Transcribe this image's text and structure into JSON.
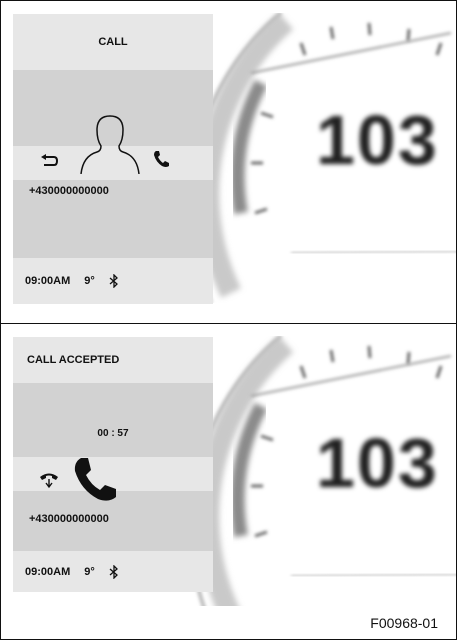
{
  "incoming_call": {
    "header": "CALL",
    "phone_number": "+430000000000",
    "status_bar": {
      "time": "09:00AM",
      "temperature": "9°",
      "bluetooth_icon": "bluetooth-icon"
    },
    "icons": [
      "back-arrow-icon",
      "person-silhouette-icon",
      "phone-handset-icon"
    ],
    "speed": "103"
  },
  "accepted_call": {
    "header": "CALL ACCEPTED",
    "call_duration": "00 : 57",
    "phone_number": "+430000000000",
    "status_bar": {
      "time": "09:00AM",
      "temperature": "9°",
      "bluetooth_icon": "bluetooth-icon"
    },
    "icons": [
      "hang-up-icon",
      "phone-handset-large-icon"
    ],
    "speed": "103"
  },
  "figure_code": "F00968-01"
}
